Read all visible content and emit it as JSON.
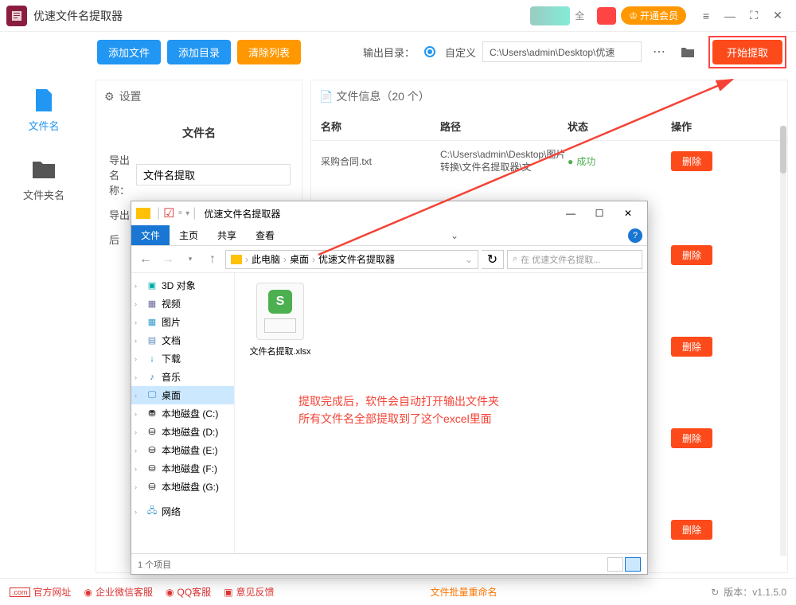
{
  "titlebar": {
    "app_title": "优速文件名提取器",
    "promo_text": "全",
    "vip_btn": "开通会员"
  },
  "toolbar": {
    "add_file": "添加文件",
    "add_dir": "添加目录",
    "clear_list": "清除列表",
    "output_label": "输出目录：",
    "custom_label": "自定义",
    "path_value": "C:\\Users\\admin\\Desktop\\优速",
    "start_btn": "开始提取"
  },
  "sidebar": {
    "nav1": "文件名",
    "nav2": "文件夹名"
  },
  "settings": {
    "header": "设置",
    "title": "文件名",
    "export_label": "导出名称：",
    "export_value": "文件名提取",
    "export2_label": "导出",
    "row3_label": "后"
  },
  "filepanel": {
    "header": "文件信息（20 个）",
    "col_name": "名称",
    "col_path": "路径",
    "col_status": "状态",
    "col_action": "操作",
    "rows": [
      {
        "name": "采购合同.txt",
        "path": "C:\\Users\\admin\\Desktop\\图片转换\\文件名提取器\\文",
        "status": "成功"
      }
    ],
    "delete_btn": "删除"
  },
  "explorer": {
    "title": "优速文件名提取器",
    "ribbon": {
      "file": "文件",
      "home": "主页",
      "share": "共享",
      "view": "查看"
    },
    "breadcrumb": {
      "pc": "此电脑",
      "desktop": "桌面",
      "folder": "优速文件名提取器"
    },
    "search_placeholder": "在 优速文件名提取...",
    "tree": {
      "3d": "3D 对象",
      "video": "视频",
      "pictures": "图片",
      "docs": "文档",
      "downloads": "下载",
      "music": "音乐",
      "desktop": "桌面",
      "disk_c": "本地磁盘 (C:)",
      "disk_d": "本地磁盘 (D:)",
      "disk_e": "本地磁盘 (E:)",
      "disk_f": "本地磁盘 (F:)",
      "disk_g": "本地磁盘 (G:)",
      "network": "网络"
    },
    "file_name": "文件名提取.xlsx",
    "annotation_l1": "提取完成后，软件会自动打开输出文件夹",
    "annotation_l2": "所有文件名全部提取到了这个excel里面",
    "status": "1 个项目"
  },
  "footer": {
    "link1": "官方网址",
    "link2": "企业微信客服",
    "link3": "QQ客服",
    "link4": "意见反馈",
    "link5": "文件批量重命名",
    "version": "版本：v1.1.5.0"
  }
}
